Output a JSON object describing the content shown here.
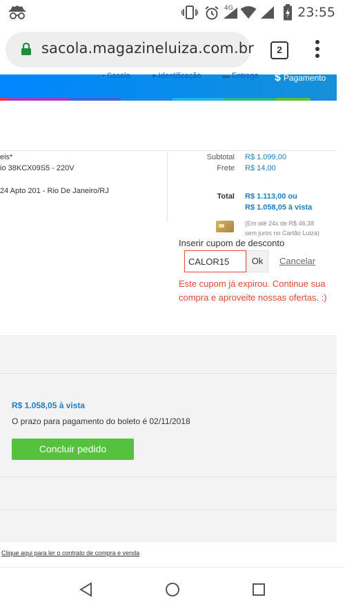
{
  "statusbar": {
    "time": "23:55",
    "network": "4G"
  },
  "browser": {
    "url": "sacola.magazineluiza.com.br",
    "tab_count": "2"
  },
  "checkout_header": {
    "steps": [
      "Sacola",
      "Identificação",
      "Entrega",
      "Pagamento"
    ],
    "active_step_icon": "$",
    "active_step": "Pagamento"
  },
  "address": {
    "line1": "eis*",
    "line2": "io 38KCX09S5 - 220V",
    "line3": "24 Apto 201 - Rio De Janeiro/RJ"
  },
  "summary": {
    "subtotal_label": "Subtotal",
    "subtotal_value": "R$ 1.099,00",
    "frete_label": "Frete",
    "frete_value": "R$ 14,00",
    "total_label": "Total",
    "total_value": "R$ 1.113,00 ou",
    "total_vista": "R$ 1.058,05 à vista",
    "installments_line1": "(Em até 24x de R$ 46,38",
    "installments_line2": "sem juros no Cartão Luiza)"
  },
  "coupon": {
    "label": "Inserir cupom de desconto",
    "value": "CALOR15",
    "ok_label": "Ok",
    "cancel_label": "Cancelar",
    "error": "Este cupom já expirou. Continue sua compra e aproveite nossas ofertas. :)"
  },
  "payment": {
    "price_vista": "R$ 1.058,05 à vista",
    "boleto_text": "O prazo para pagamento do boleto é 02/11/2018",
    "conclude_label": "Concluir pedido"
  },
  "footer": {
    "contract_link": "Clique aqui para ler o contrato de compra e venda"
  },
  "colors": {
    "brand_blue": "#0086ff",
    "link_blue": "#1a7fc1",
    "error_red": "#e04a3a",
    "button_green": "#56c13c"
  }
}
